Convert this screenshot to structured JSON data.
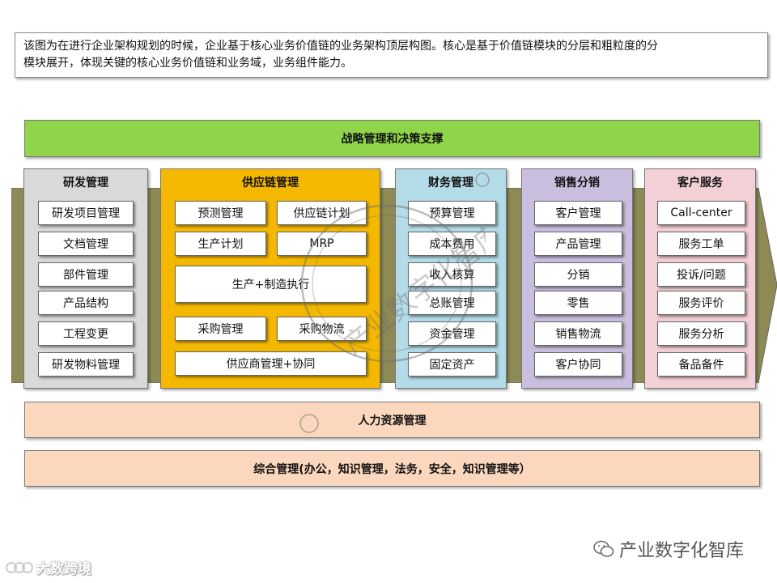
{
  "description": {
    "line1": "该图为在进行企业架构规划的时候，企业基于核心业务价值链的业务架构顶层构图。核心是基于价值链模块的分层和粗粒度的分",
    "line2": "模块展开，体现关键的核心业务价值链和业务域，业务组件能力。"
  },
  "top_band": "战略管理和决策支撑",
  "columns": {
    "rd": {
      "title": "研发管理",
      "items": [
        "研发项目管理",
        "文档管理",
        "部件管理",
        "产品结构",
        "工程变更",
        "研发物料管理"
      ]
    },
    "supply_chain": {
      "title": "供应链管理",
      "items": [
        "预测管理",
        "供应链计划",
        "生产计划",
        "MRP",
        "生产+制造执行",
        "采购管理",
        "采购物流",
        "供应商管理+协同"
      ]
    },
    "finance": {
      "title": "财务管理",
      "items": [
        "预算管理",
        "成本费用",
        "收入核算",
        "总账管理",
        "资金管理",
        "固定资产"
      ]
    },
    "sales": {
      "title": "销售分销",
      "items": [
        "客户管理",
        "产品管理",
        "分销",
        "零售",
        "销售物流",
        "客户协同"
      ]
    },
    "service": {
      "title": "客户服务",
      "items": [
        "Call-center",
        "服务工单",
        "投诉/问题",
        "服务评价",
        "服务分析",
        "备品备件"
      ]
    }
  },
  "hr_band": "人力资源管理",
  "general_band": "综合管理(办公，知识管理，法务，安全，知识管理等）",
  "watermarks": {
    "seal_text": "产业数字化智库",
    "brand": "产业数字化智库",
    "corner": "大数跨境"
  },
  "colors": {
    "strategy": "#8fd44a",
    "arrow": "#8d8a56",
    "rd": "#d9d9d9",
    "supply_chain": "#f5b800",
    "finance": "#b3dbe8",
    "sales": "#c9bedd",
    "service": "#f3d0d6",
    "bottom_bands": "#fbd7bd"
  }
}
